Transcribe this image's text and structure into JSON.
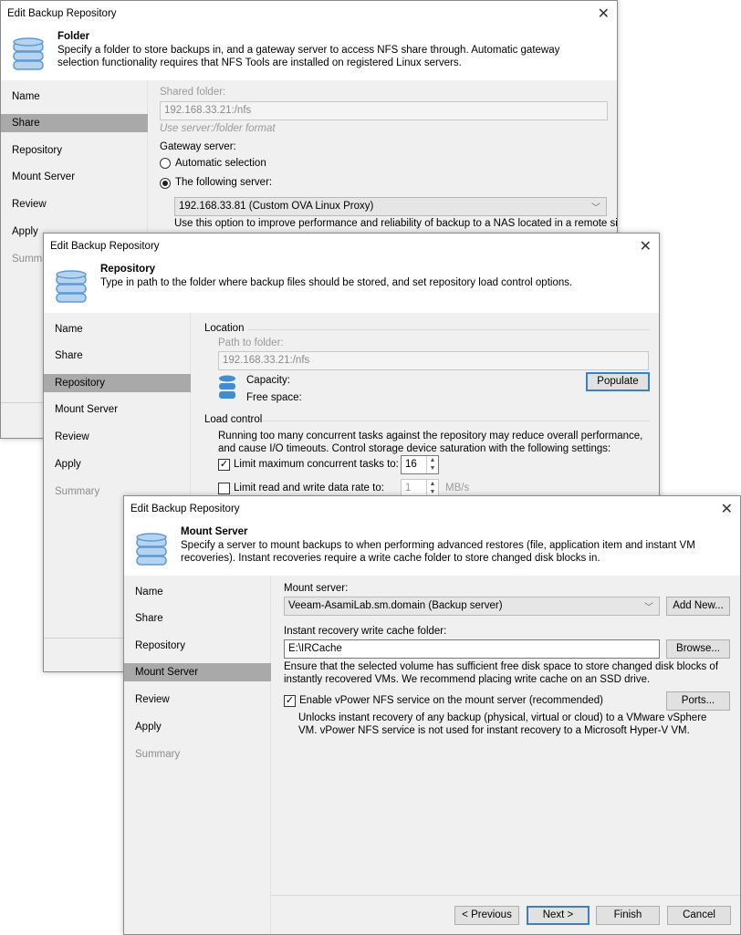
{
  "window_title": "Edit Backup Repository",
  "steps": [
    "Name",
    "Share",
    "Repository",
    "Mount Server",
    "Review",
    "Apply",
    "Summary"
  ],
  "colors": {
    "accent": "#3c7fc4",
    "selected_step": "#a9a9a9",
    "db_icon": "#5b9bd5"
  },
  "folder": {
    "title": "Folder",
    "description": "Specify a folder to store backups in, and a gateway server to access NFS share through. Automatic gateway selection functionality requires that NFS Tools are installed on registered Linux servers.",
    "shared_folder_label": "Shared folder:",
    "shared_folder_value": "192.168.33.21:/nfs",
    "format_hint": "Use server:/folder format",
    "gateway_label": "Gateway server:",
    "automatic_label": "Automatic selection",
    "following_label": "The following server:",
    "server_value": "192.168.33.81 (Custom OVA Linux Proxy)",
    "server_note": "Use this option to improve performance and reliability of backup to a NAS located in a remote site."
  },
  "repository": {
    "title": "Repository",
    "description": "Type in path to the folder where backup files should be stored, and set repository load control options.",
    "location_label": "Location",
    "path_label": "Path to folder:",
    "path_value": "192.168.33.21:/nfs",
    "capacity_label": "Capacity:",
    "free_space_label": "Free space:",
    "populate_label": "Populate",
    "load_control_label": "Load control",
    "load_control_text": "Running too many concurrent tasks against the repository may reduce overall performance, and cause I/O timeouts. Control storage device saturation with the following settings:",
    "limit_tasks_label": "Limit maximum concurrent tasks to:",
    "limit_tasks_value": "16",
    "limit_rate_label": "Limit read and write data rate to:",
    "limit_rate_value": "1",
    "rate_unit": "MB/s"
  },
  "mount": {
    "title": "Mount Server",
    "description": "Specify a server to mount backups to when performing advanced restores (file, application item and instant VM recoveries). Instant recoveries require a write cache folder to store changed disk blocks in.",
    "mount_server_label": "Mount server:",
    "mount_server_value": "Veeam-AsamiLab.sm.domain (Backup server)",
    "add_new_label": "Add New...",
    "cache_label": "Instant recovery write cache folder:",
    "cache_value": "E:\\IRCache",
    "browse_label": "Browse...",
    "cache_note": "Ensure that the selected volume has sufficient free disk space to store changed disk blocks of instantly recovered VMs. We recommend placing write cache on an SSD drive.",
    "vpower_label": "Enable vPower NFS service on the mount server (recommended)",
    "ports_label": "Ports...",
    "vpower_note": "Unlocks instant recovery of any backup (physical, virtual or cloud) to a VMware vSphere VM. vPower NFS service is not used for instant recovery to a Microsoft Hyper-V VM."
  },
  "buttons": {
    "previous": "< Previous",
    "next": "Next >",
    "finish": "Finish",
    "cancel": "Cancel"
  }
}
